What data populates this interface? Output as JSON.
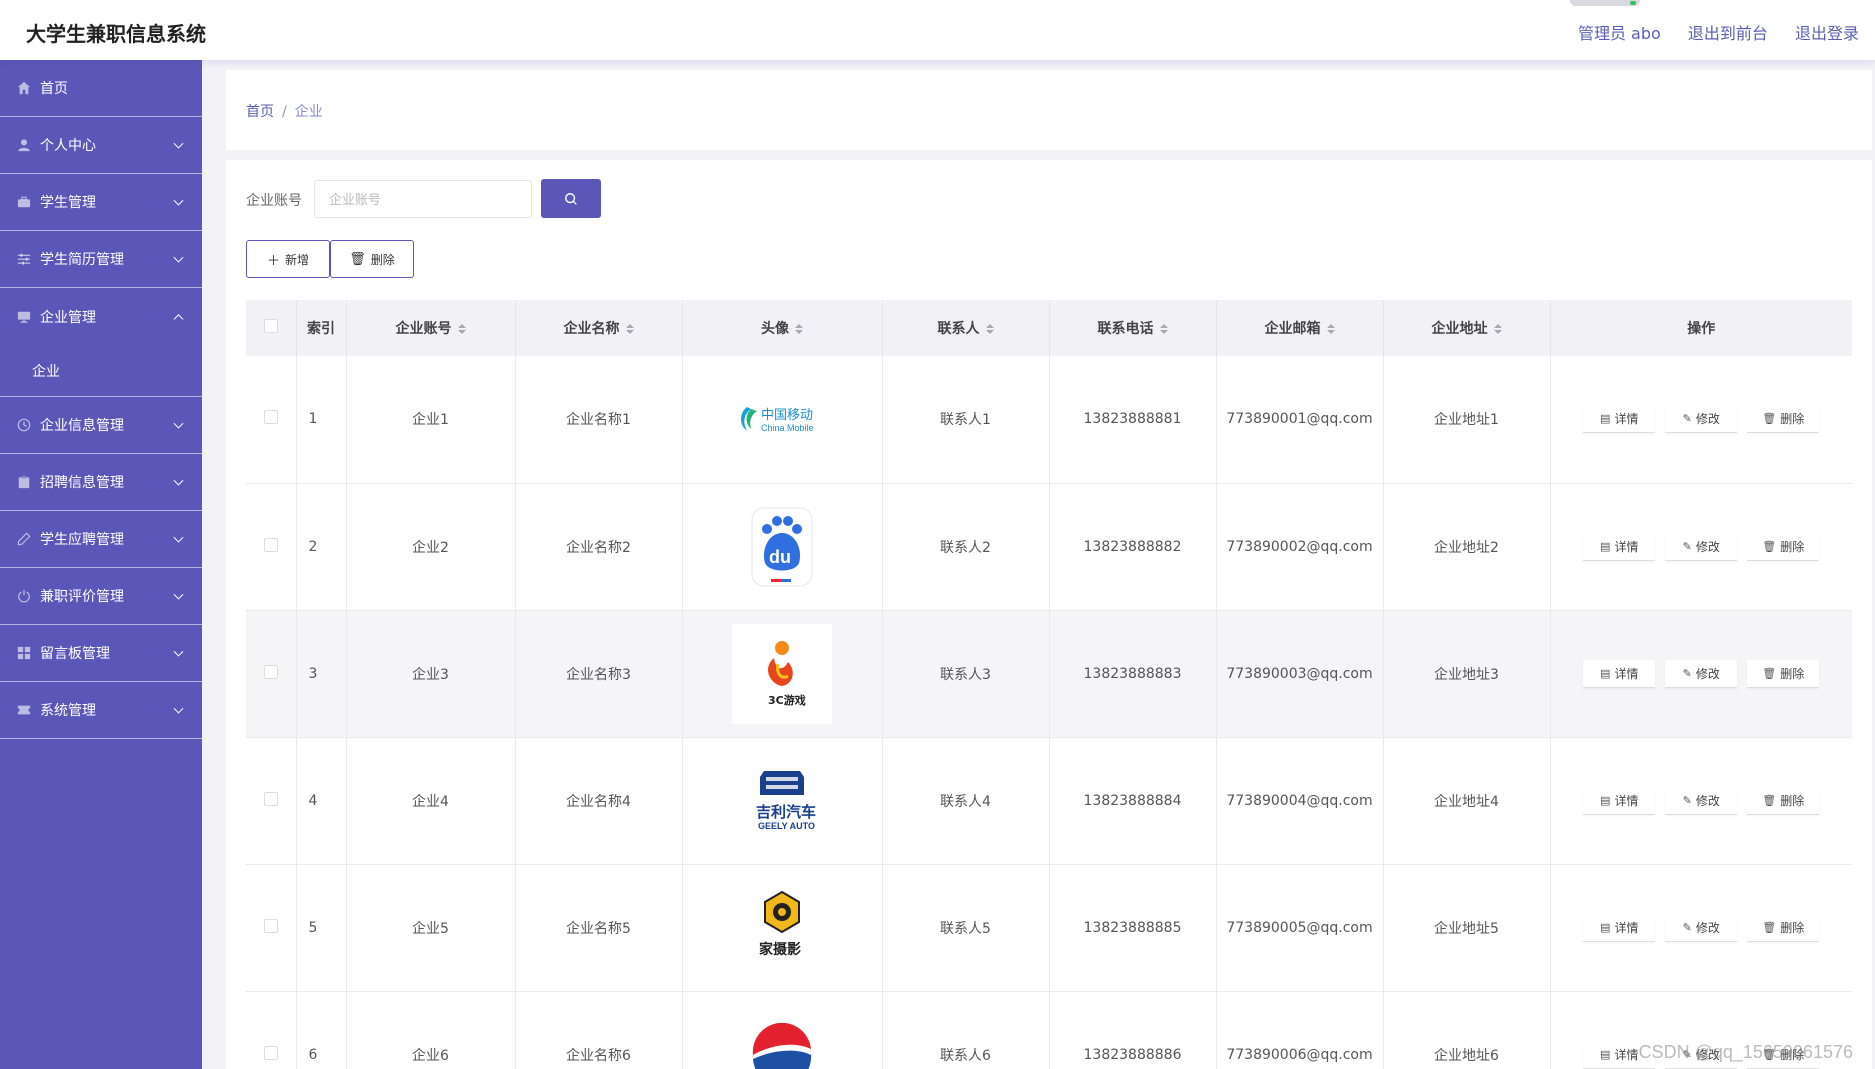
{
  "header": {
    "title": "大学生兼职信息系统",
    "links": [
      "管理员 abo",
      "退出到前台",
      "退出登录"
    ]
  },
  "sidebar": {
    "items": [
      {
        "label": "首页",
        "icon": "home-icon",
        "expandable": false
      },
      {
        "label": "个人中心",
        "icon": "user-icon",
        "expandable": true
      },
      {
        "label": "学生管理",
        "icon": "briefcase-icon",
        "expandable": true
      },
      {
        "label": "学生简历管理",
        "icon": "sliders-icon",
        "expandable": true
      },
      {
        "label": "企业管理",
        "icon": "monitor-icon",
        "expandable": true,
        "expanded": true
      },
      {
        "label": "企业",
        "sub": true
      },
      {
        "label": "企业信息管理",
        "icon": "clock-icon",
        "expandable": true
      },
      {
        "label": "招聘信息管理",
        "icon": "clipboard-icon",
        "expandable": true
      },
      {
        "label": "学生应聘管理",
        "icon": "pen-icon",
        "expandable": true
      },
      {
        "label": "兼职评价管理",
        "icon": "power-icon",
        "expandable": true
      },
      {
        "label": "留言板管理",
        "icon": "grid-icon",
        "expandable": true
      },
      {
        "label": "系统管理",
        "icon": "ticket-icon",
        "expandable": true
      }
    ]
  },
  "breadcrumb": {
    "home": "首页",
    "separator": "/",
    "current": "企业"
  },
  "search": {
    "label": "企业账号",
    "placeholder": "企业账号"
  },
  "toolbar": {
    "add_label": "新增",
    "delete_label": "删除"
  },
  "table": {
    "headers": [
      "索引",
      "企业账号",
      "企业名称",
      "头像",
      "联系人",
      "联系电话",
      "企业邮箱",
      "企业地址",
      "操作"
    ],
    "rows": [
      {
        "index": "1",
        "account": "企业1",
        "name": "企业名称1",
        "logo": "china-mobile",
        "contact": "联系人1",
        "phone": "13823888881",
        "email": "773890001@qq.com",
        "address": "企业地址1"
      },
      {
        "index": "2",
        "account": "企业2",
        "name": "企业名称2",
        "logo": "baidu",
        "contact": "联系人2",
        "phone": "13823888882",
        "email": "773890002@qq.com",
        "address": "企业地址2"
      },
      {
        "index": "3",
        "account": "企业3",
        "name": "企业名称3",
        "logo": "3c-games",
        "contact": "联系人3",
        "phone": "13823888883",
        "email": "773890003@qq.com",
        "address": "企业地址3"
      },
      {
        "index": "4",
        "account": "企业4",
        "name": "企业名称4",
        "logo": "geely-auto",
        "contact": "联系人4",
        "phone": "13823888884",
        "email": "773890004@qq.com",
        "address": "企业地址4"
      },
      {
        "index": "5",
        "account": "企业5",
        "name": "企业名称5",
        "logo": "photography",
        "contact": "联系人5",
        "phone": "13823888885",
        "email": "773890005@qq.com",
        "address": "企业地址5"
      },
      {
        "index": "6",
        "account": "企业6",
        "name": "企业名称6",
        "logo": "pepsi",
        "contact": "联系人6",
        "phone": "13823888886",
        "email": "773890006@qq.com",
        "address": "企业地址6"
      }
    ],
    "row_actions": {
      "detail": "详情",
      "edit": "修改",
      "delete": "删除"
    }
  },
  "logos": {
    "china_mobile": {
      "cn": "中国移动",
      "en": "China Mobile"
    },
    "baidu": {
      "text": "du"
    },
    "games": {
      "text": "3C游戏"
    },
    "geely": {
      "cn": "吉利汽车",
      "en": "GEELY AUTO"
    },
    "photo": {
      "text": "家摄影"
    }
  },
  "colors": {
    "primary": "#5b57b8",
    "header_link": "#5a5fb4"
  },
  "watermark": "CSDN @qq_15659061576"
}
